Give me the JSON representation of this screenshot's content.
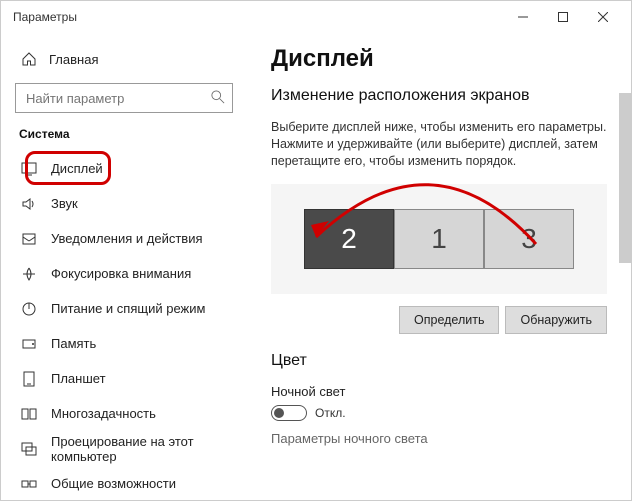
{
  "window": {
    "title": "Параметры"
  },
  "sidebar": {
    "home": "Главная",
    "search_placeholder": "Найти параметр",
    "category": "Система",
    "items": [
      {
        "label": "Дисплей"
      },
      {
        "label": "Звук"
      },
      {
        "label": "Уведомления и действия"
      },
      {
        "label": "Фокусировка внимания"
      },
      {
        "label": "Питание и спящий режим"
      },
      {
        "label": "Память"
      },
      {
        "label": "Планшет"
      },
      {
        "label": "Многозадачность"
      },
      {
        "label": "Проецирование на этот компьютер"
      },
      {
        "label": "Общие возможности"
      }
    ]
  },
  "main": {
    "heading": "Дисплей",
    "subheading": "Изменение расположения экранов",
    "instruction": "Выберите дисплей ниже, чтобы изменить его параметры. Нажмите и удерживайте (или выберите) дисплей, затем перетащите его, чтобы изменить порядок.",
    "monitors": [
      "2",
      "1",
      "3"
    ],
    "btn_identify": "Определить",
    "btn_detect": "Обнаружить",
    "color_heading": "Цвет",
    "night_label": "Ночной свет",
    "night_state": "Откл.",
    "night_params": "Параметры ночного света"
  }
}
